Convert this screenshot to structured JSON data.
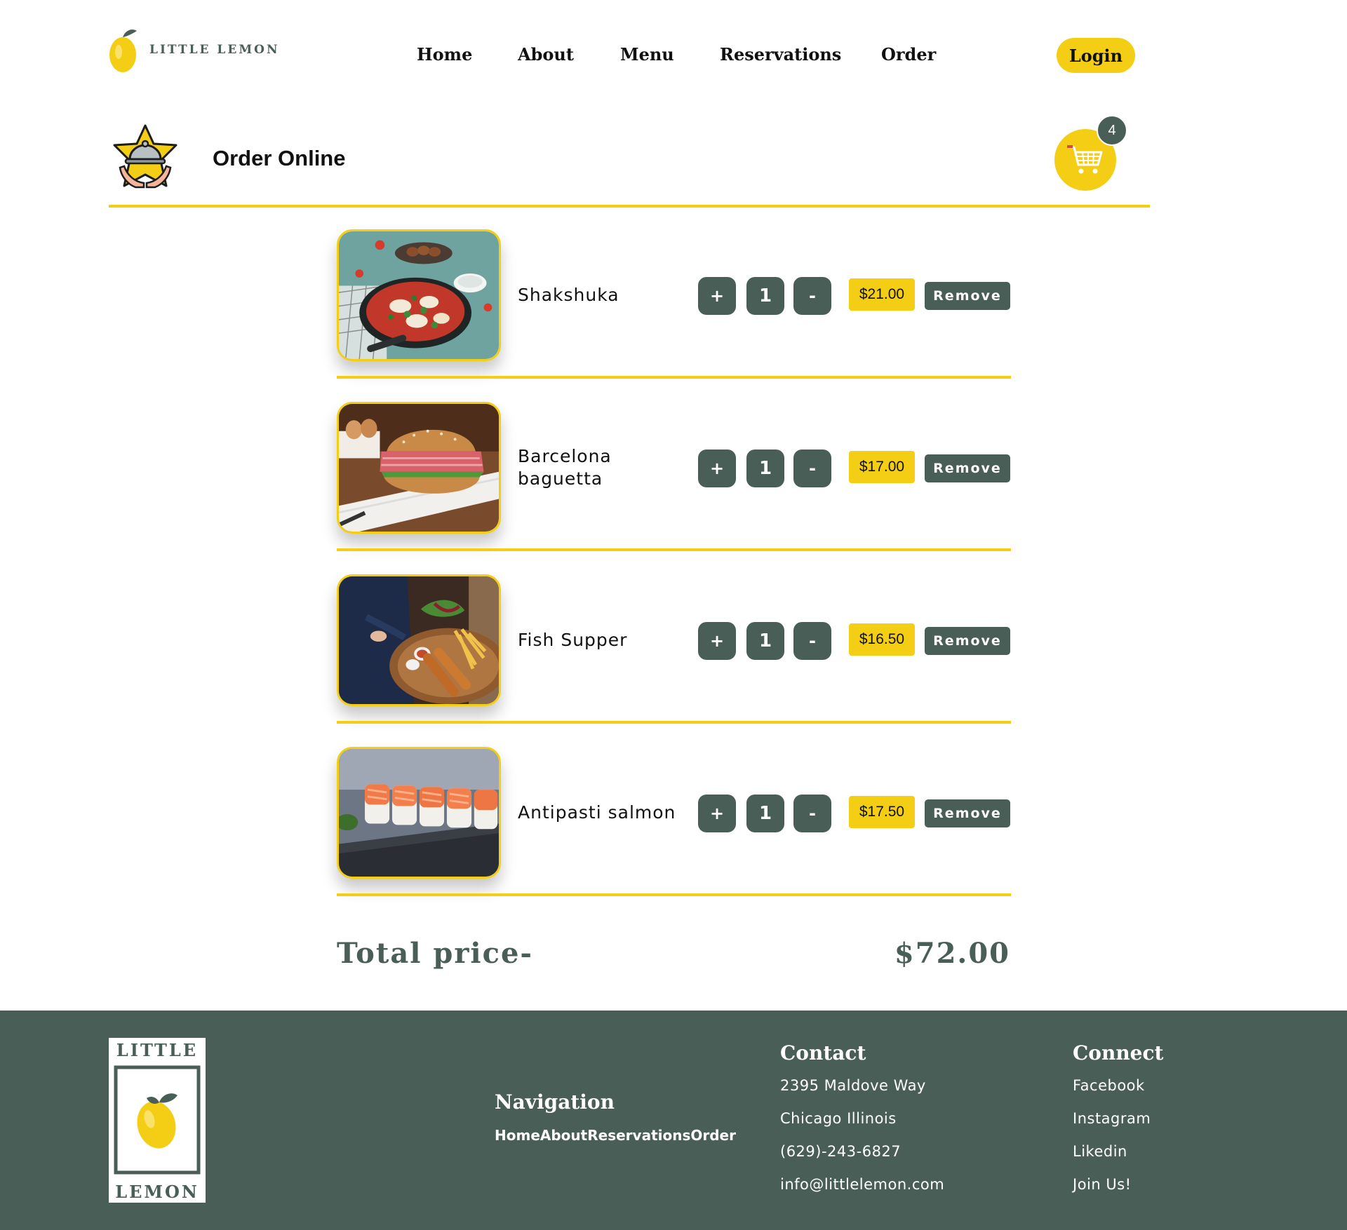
{
  "brand": {
    "logo_text": "LITTLE LEMON",
    "accent": "#f4ce14",
    "primary": "#495e57"
  },
  "nav": {
    "items": [
      {
        "label": "Home"
      },
      {
        "label": "About"
      },
      {
        "label": "Menu"
      },
      {
        "label": "Reservations"
      },
      {
        "label": "Order"
      }
    ],
    "login_label": "Login"
  },
  "order": {
    "title": "Order Online",
    "cart_count": "4",
    "cart_icon": "shopping-cart-icon",
    "order_icon": "serving-dish-icon"
  },
  "items": [
    {
      "name": "Shakshuka",
      "quantity": "1",
      "price": "$21.00",
      "plus": "+",
      "minus": "-",
      "remove": "Remove"
    },
    {
      "name": "Barcelona baguetta",
      "quantity": "1",
      "price": "$17.00",
      "plus": "+",
      "minus": "-",
      "remove": "Remove"
    },
    {
      "name": "Fish Supper",
      "quantity": "1",
      "price": "$16.50",
      "plus": "+",
      "minus": "-",
      "remove": "Remove"
    },
    {
      "name": "Antipasti salmon",
      "quantity": "1",
      "price": "$17.50",
      "plus": "+",
      "minus": "-",
      "remove": "Remove"
    }
  ],
  "total": {
    "label": "Total price-",
    "value": "$72.00"
  },
  "footer": {
    "logo_top": "LITTLE",
    "logo_bottom": "LEMON",
    "navigation": {
      "heading": "Navigation",
      "links": [
        "Home",
        "About",
        "Reservations",
        "Order"
      ]
    },
    "contact": {
      "heading": "Contact",
      "address": "2395 Maldove Way",
      "city": "Chicago Illinois",
      "phone": "(629)-243-6827",
      "email": "info@littlelemon.com"
    },
    "connect": {
      "heading": "Connect",
      "links": [
        "Facebook",
        "Instagram",
        "Likedin",
        "Join Us!"
      ]
    }
  }
}
